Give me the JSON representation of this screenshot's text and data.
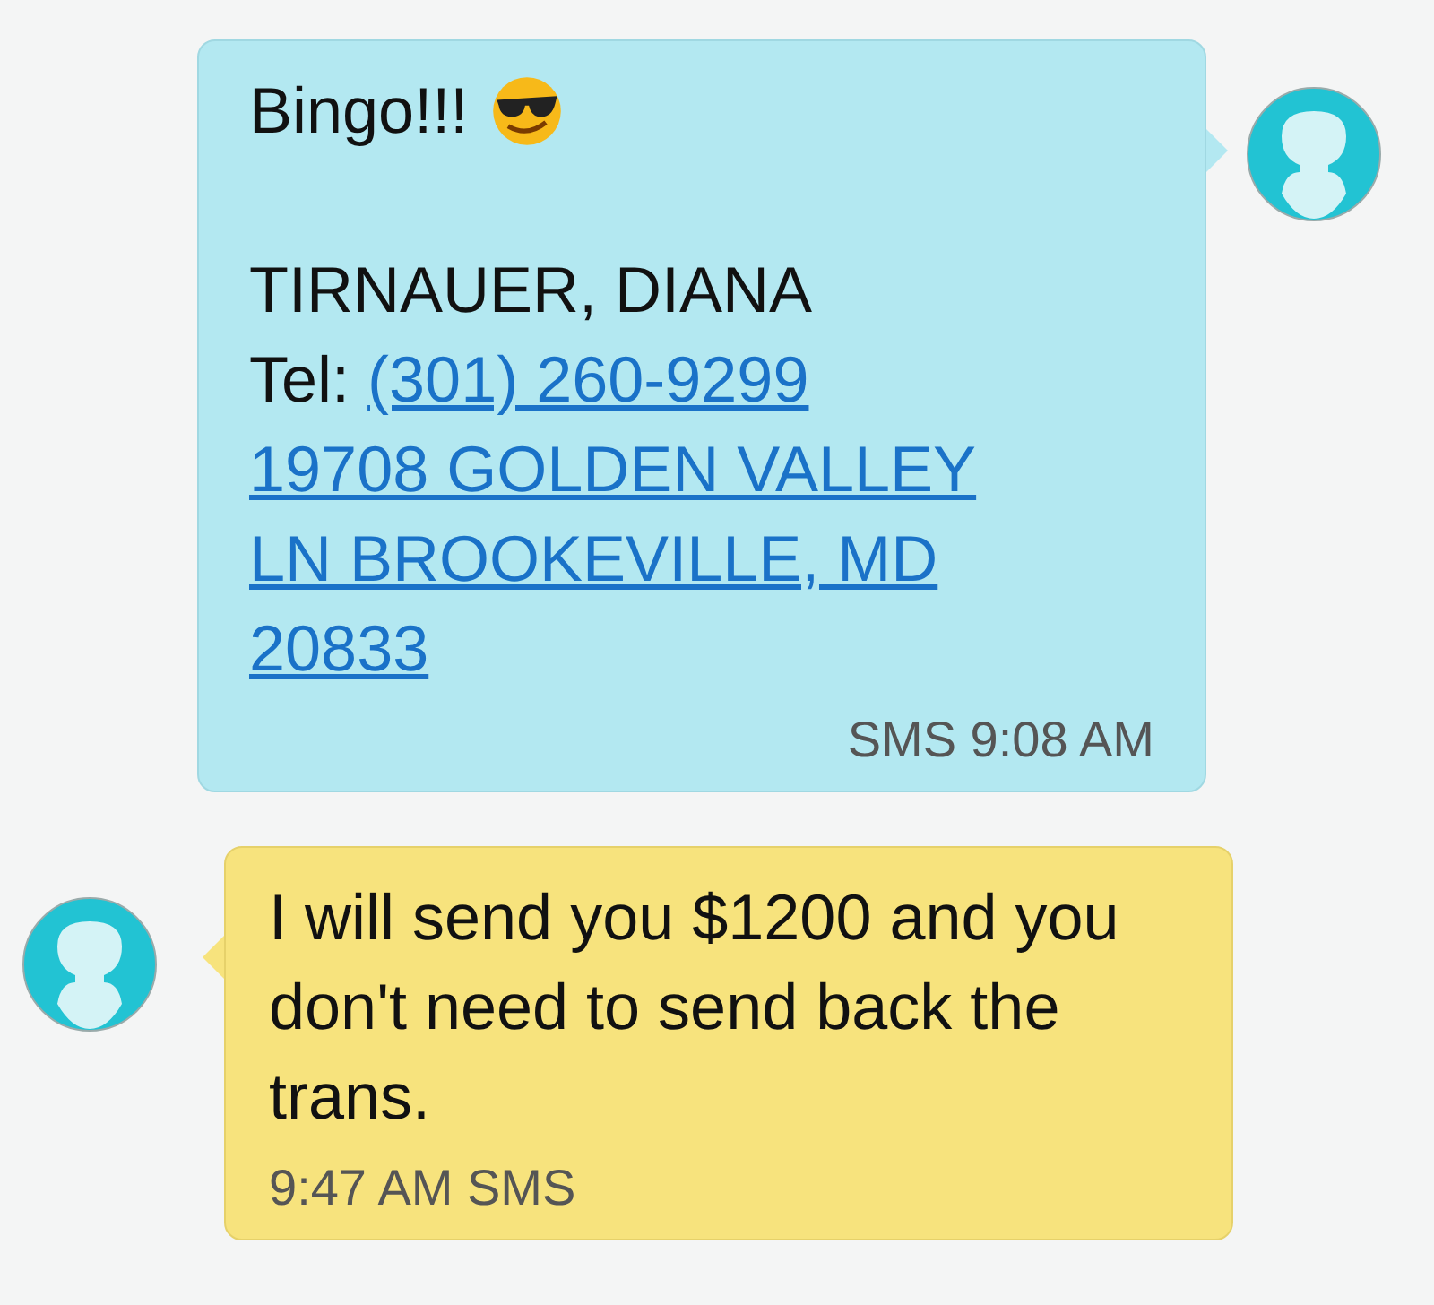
{
  "messages": [
    {
      "kind": "sent",
      "heading": "Bingo!!!",
      "emoji": true,
      "name": "TIRNAUER, DIANA",
      "tel_label": "Tel:",
      "tel": "(301) 260-9299",
      "address_lines": [
        "19708 GOLDEN VALLEY",
        "LN BROOKEVILLE, MD",
        "20833"
      ],
      "meta": "SMS 9:08 AM"
    },
    {
      "kind": "received",
      "text": "I will send you $1200 and you don't need to send back the trans.",
      "meta": "9:47 AM SMS"
    }
  ]
}
